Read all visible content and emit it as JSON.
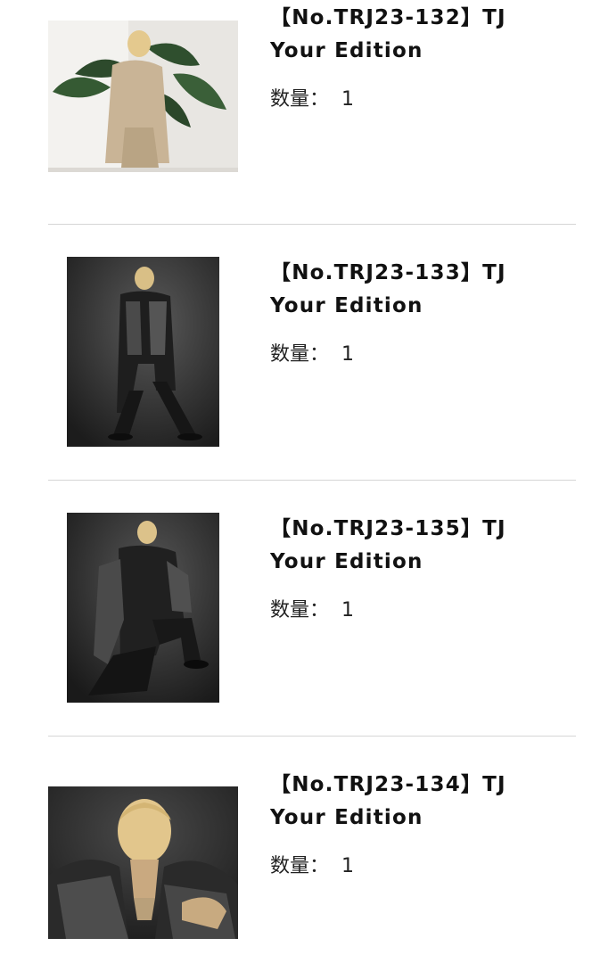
{
  "items": [
    {
      "title_line1": "【No.TRJ23-132】TJ",
      "title_line2": "Your Edition",
      "qty_label": "数量：",
      "qty_value": "1"
    },
    {
      "title_line1": "【No.TRJ23-133】TJ",
      "title_line2": "Your Edition",
      "qty_label": "数量：",
      "qty_value": "1"
    },
    {
      "title_line1": "【No.TRJ23-135】TJ",
      "title_line2": "Your Edition",
      "qty_label": "数量：",
      "qty_value": "1"
    },
    {
      "title_line1": "【No.TRJ23-134】TJ",
      "title_line2": "Your Edition",
      "qty_label": "数量：",
      "qty_value": "1"
    }
  ]
}
